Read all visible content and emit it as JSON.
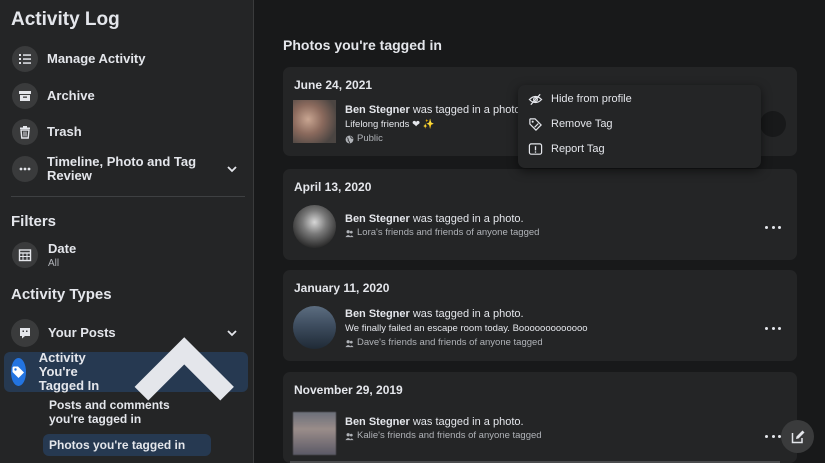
{
  "sidebar": {
    "title": "Activity Log",
    "items": [
      {
        "label": "Manage Activity",
        "icon": "list-icon"
      },
      {
        "label": "Archive",
        "icon": "archive-icon"
      },
      {
        "label": "Trash",
        "icon": "trash-icon"
      },
      {
        "label": "Timeline, Photo and Tag Review",
        "icon": "more-dots-icon"
      }
    ],
    "filters_title": "Filters",
    "date_filter": {
      "label": "Date",
      "value": "All"
    },
    "activity_types_title": "Activity Types",
    "your_posts": "Your Posts",
    "tagged_in": "Activity You're Tagged In",
    "sub_items": [
      "Posts and comments you're tagged in",
      "Photos you're tagged in"
    ]
  },
  "main": {
    "title": "Photos you're tagged in",
    "cards": [
      {
        "date": "June 24, 2021",
        "name": "Ben Stegner",
        "action": " was tagged in a photo.",
        "caption": "Lifelong friends ❤ ✨",
        "audience": "Public"
      },
      {
        "date": "April 13, 2020",
        "name": "Ben Stegner",
        "action": " was tagged in a photo.",
        "audience": "Lora's friends and friends of anyone tagged"
      },
      {
        "date": "January 11, 2020",
        "name": "Ben Stegner",
        "action": " was tagged in a photo.",
        "caption": "We finally failed an escape room today. Booooooooooooo",
        "audience": "Dave's friends and friends of anyone tagged"
      },
      {
        "date": "November 29, 2019",
        "name": "Ben Stegner",
        "action": " was tagged in a photo.",
        "audience": "Kalie's friends and friends of anyone tagged"
      }
    ]
  },
  "menu": {
    "items": [
      {
        "label": "Hide from profile",
        "icon": "eye-slash-icon"
      },
      {
        "label": "Remove Tag",
        "icon": "tag-remove-icon"
      },
      {
        "label": "Report Tag",
        "icon": "report-icon"
      }
    ]
  },
  "colors": {
    "accent": "#2374e1",
    "background": "#18191a",
    "surface": "#242526",
    "selected": "#263951"
  }
}
